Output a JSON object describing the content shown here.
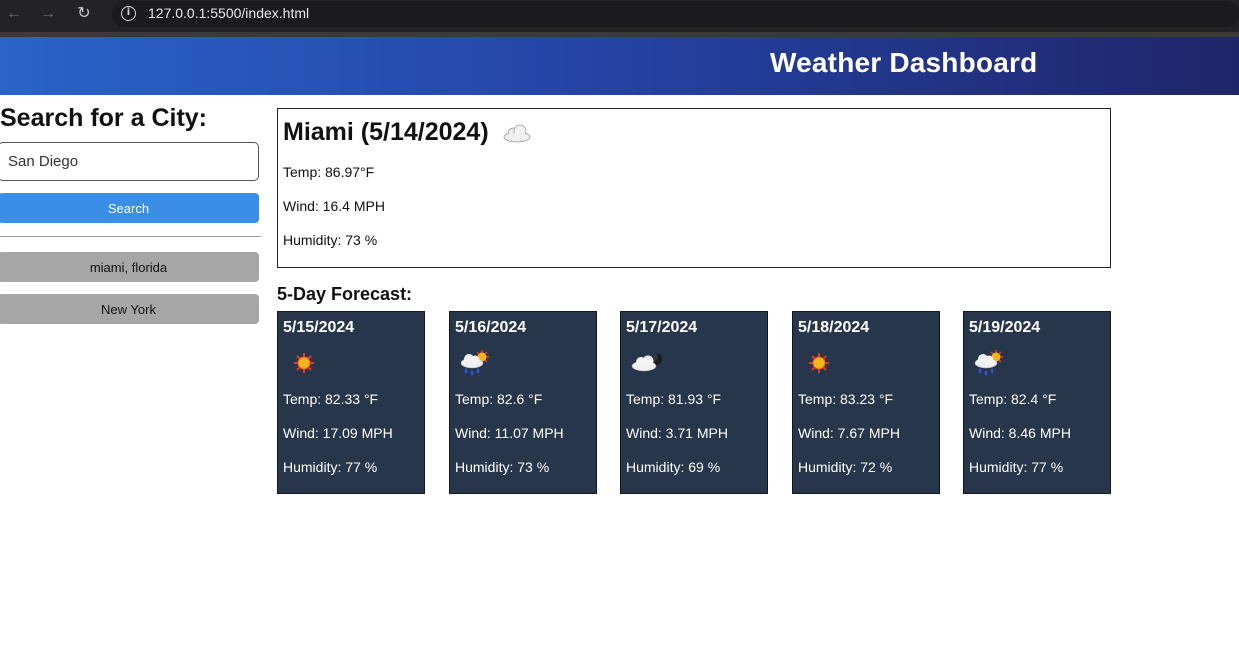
{
  "browser": {
    "url": "127.0.0.1:5500/index.html"
  },
  "header": {
    "title": "Weather Dashboard"
  },
  "sidebar": {
    "heading": "Search for a City:",
    "search_value": "San Diego",
    "search_button": "Search",
    "history": [
      "miami, florida",
      "New York"
    ]
  },
  "current": {
    "title": "Miami (5/14/2024)",
    "icon": "cloud-icon",
    "temp": "Temp: 86.97°F",
    "wind": "Wind: 16.4 MPH",
    "humidity": "Humidity: 73 %"
  },
  "forecast": {
    "heading": "5-Day Forecast:",
    "days": [
      {
        "date": "5/15/2024",
        "icon": "sun-icon",
        "temp": "Temp: 82.33 °F",
        "wind": "Wind: 17.09 MPH",
        "humidity": "Humidity: 77 %"
      },
      {
        "date": "5/16/2024",
        "icon": "rain-sun-icon",
        "temp": "Temp: 82.6 °F",
        "wind": "Wind: 11.07 MPH",
        "humidity": "Humidity: 73 %"
      },
      {
        "date": "5/17/2024",
        "icon": "cloud-moon-icon",
        "temp": "Temp: 81.93 °F",
        "wind": "Wind: 3.71 MPH",
        "humidity": "Humidity: 69 %"
      },
      {
        "date": "5/18/2024",
        "icon": "sun-icon",
        "temp": "Temp: 83.23 °F",
        "wind": "Wind: 7.67 MPH",
        "humidity": "Humidity: 72 %"
      },
      {
        "date": "5/19/2024",
        "icon": "rain-sun-icon",
        "temp": "Temp: 82.4 °F",
        "wind": "Wind: 8.46 MPH",
        "humidity": "Humidity: 77 %"
      }
    ]
  }
}
